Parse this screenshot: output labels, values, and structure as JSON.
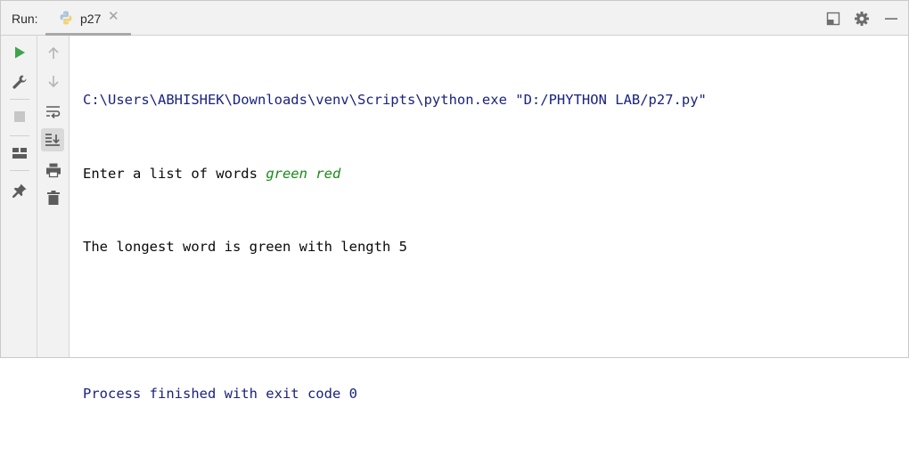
{
  "toolbar": {
    "run_label": "Run:"
  },
  "tab": {
    "title": "p27",
    "close_glyph": "✕"
  },
  "console": {
    "command": "C:\\Users\\ABHISHEK\\Downloads\\venv\\Scripts\\python.exe \"D:/PHYTHON LAB/p27.py\"",
    "prompt": "Enter a list of words ",
    "user_input": "green red",
    "result": "The longest word is green with length 5",
    "blank": "",
    "exit_message": "Process finished with exit code 0"
  },
  "colors": {
    "system_text": "#1a237e",
    "user_input": "#178a17",
    "run_green": "#3fa34d"
  },
  "icons": {
    "left_toolbar": [
      "run-icon",
      "wrench-icon",
      "stop-icon",
      "layout-icon",
      "pin-icon"
    ],
    "console_toolbar": [
      "up-arrow-icon",
      "down-arrow-icon",
      "soft-wrap-icon",
      "scroll-to-end-icon",
      "print-icon",
      "trash-icon"
    ],
    "top_right": [
      "restore-layout-icon",
      "gear-icon",
      "minimize-icon"
    ]
  }
}
